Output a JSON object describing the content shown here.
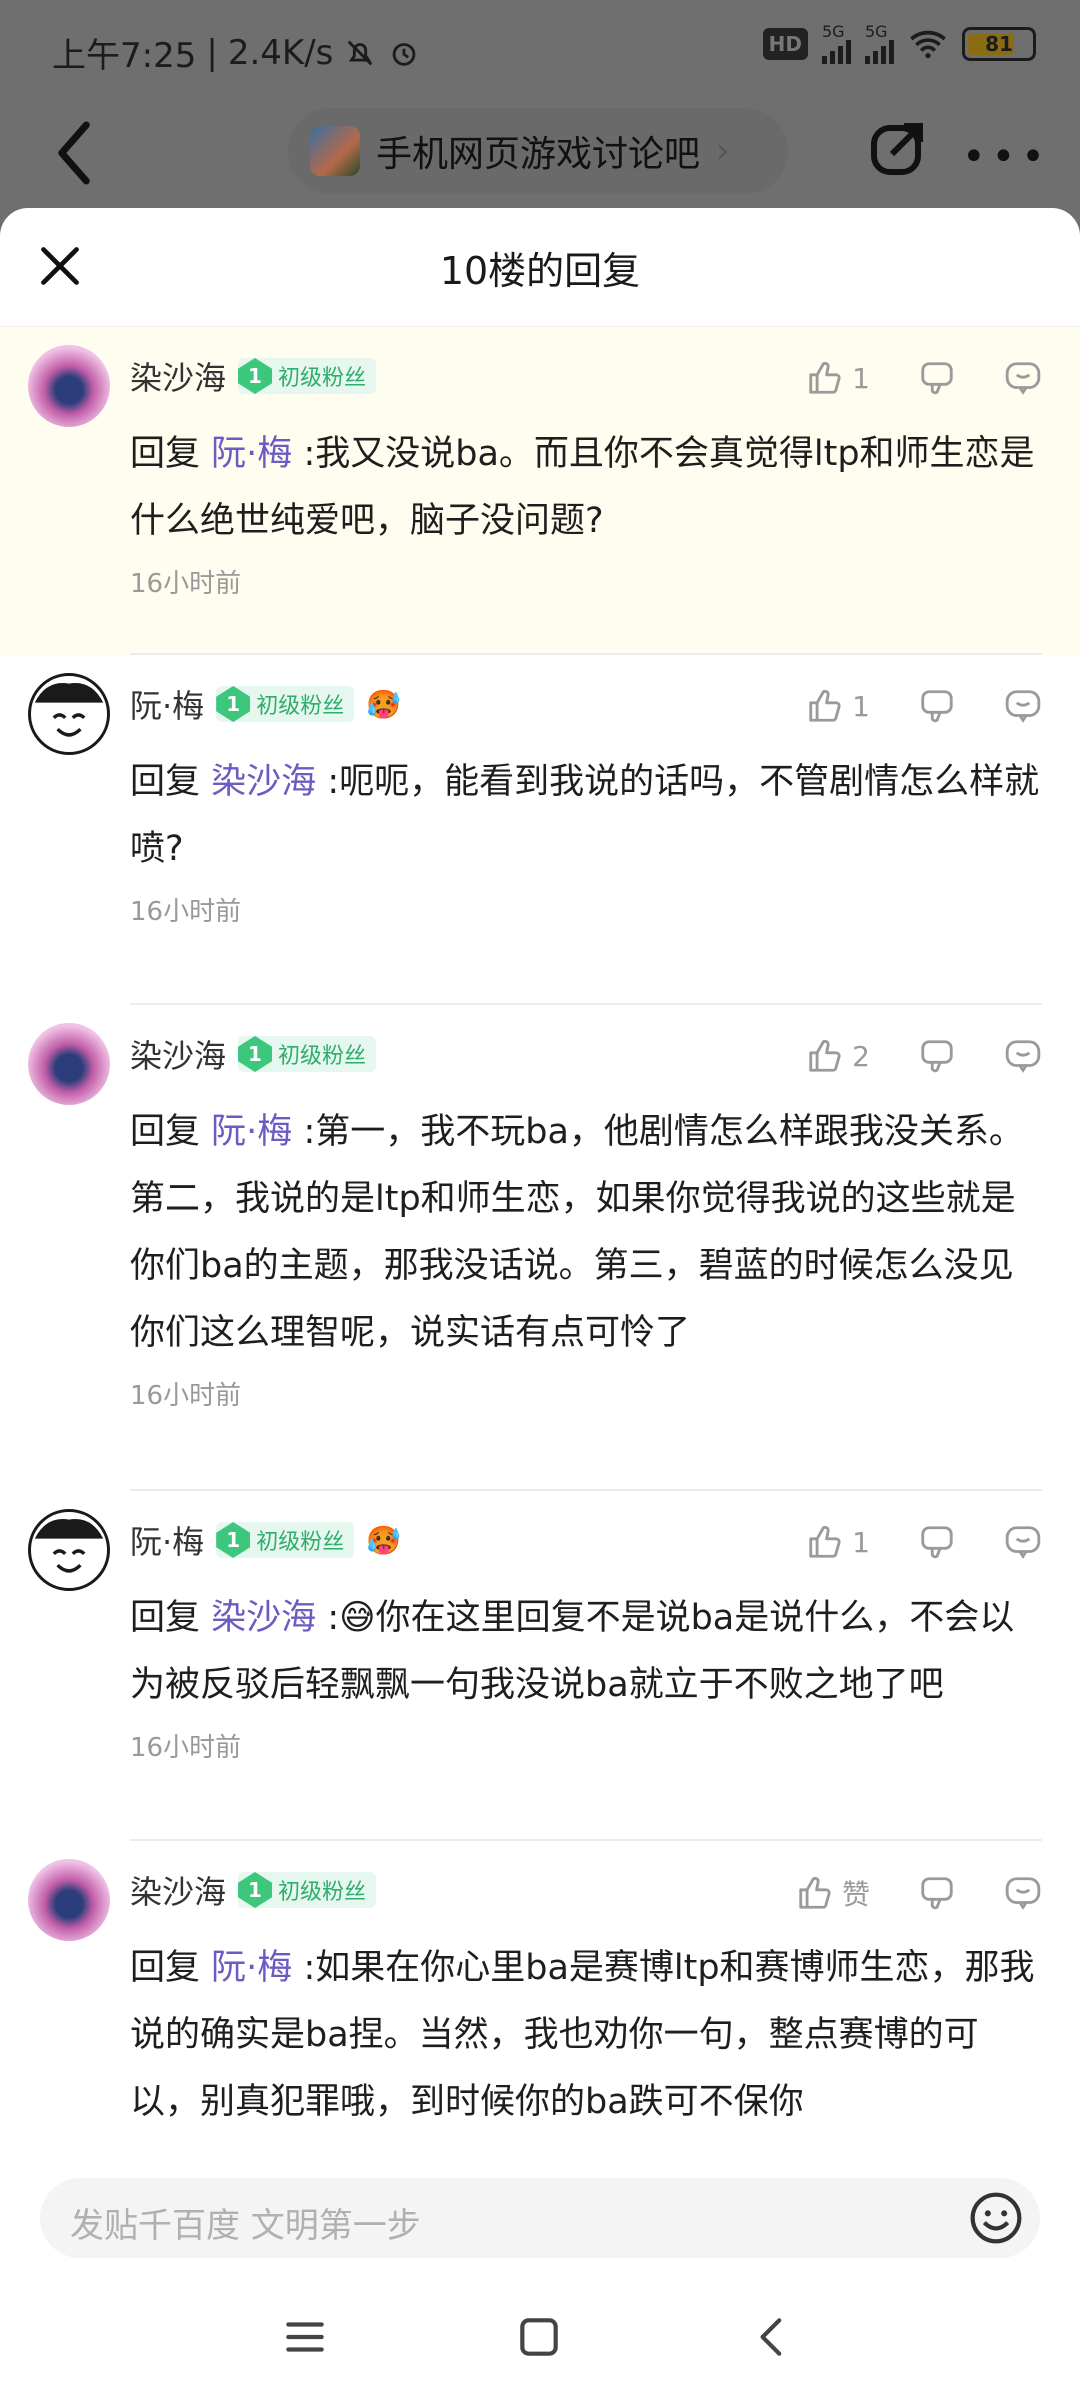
{
  "status_bar": {
    "time": "上午7:25",
    "speed": "2.4K/s",
    "hd": "HD",
    "net1": "5G",
    "net2": "5G",
    "battery": "81",
    "battery_fraction": 0.81
  },
  "nav": {
    "forum_name": "手机网页游戏讨论吧"
  },
  "sheet": {
    "title": "10楼的回复"
  },
  "replies": [
    {
      "user": "染沙海",
      "avatar": "anime-avatar",
      "fan_level": "1",
      "fan_title": "初级粉丝",
      "extra_badge": "",
      "likes": "1",
      "reply_prefix": "回复",
      "reply_to": "阮·梅",
      "text": ":我又没说ba。而且你不会真觉得ltp和师生恋是什么绝世纯爱吧，脑子没问题?",
      "time": "16小时前",
      "highlight": true
    },
    {
      "user": "阮·梅",
      "avatar": "smile-avatar",
      "fan_level": "1",
      "fan_title": "初级粉丝",
      "extra_badge": "🥵",
      "likes": "1",
      "reply_prefix": "回复",
      "reply_to": "染沙海",
      "text": ":呃呃，能看到我说的话吗，不管剧情怎么样就喷?",
      "time": "16小时前"
    },
    {
      "user": "染沙海",
      "avatar": "anime-avatar",
      "fan_level": "1",
      "fan_title": "初级粉丝",
      "extra_badge": "",
      "likes": "2",
      "reply_prefix": "回复",
      "reply_to": "阮·梅",
      "text": ":第一，我不玩ba，他剧情怎么样跟我没关系。第二，我说的是ltp和师生恋，如果你觉得我说的这些就是你们ba的主题，那我没话说。第三，碧蓝的时候怎么没见你们这么理智呢，说实话有点可怜了",
      "time": "16小时前"
    },
    {
      "user": "阮·梅",
      "avatar": "smile-avatar",
      "fan_level": "1",
      "fan_title": "初级粉丝",
      "extra_badge": "🥵",
      "likes": "1",
      "reply_prefix": "回复",
      "reply_to": "染沙海",
      "text": ":😅你在这里回复不是说ba是说什么，不会以为被反驳后轻飘飘一句我没说ba就立于不败之地了吧",
      "time": "16小时前"
    },
    {
      "user": "染沙海",
      "avatar": "anime-avatar",
      "fan_level": "1",
      "fan_title": "初级粉丝",
      "extra_badge": "",
      "likes": "赞",
      "reply_prefix": "回复",
      "reply_to": "阮·梅",
      "text": ":如果在你心里ba是赛博ltp和赛博师生恋，那我说的确实是ba捏。当然，我也劝你一句，整点赛博的可以，别真犯罪哦，到时候你的ba跌可不保你",
      "time": ""
    }
  ],
  "composer": {
    "placeholder": "发贴千百度 文明第一步"
  },
  "icons": {
    "like": "thumbs-up-icon",
    "dislike": "thumbs-down-icon",
    "comment": "comment-icon",
    "emoji": "emoji-icon"
  }
}
